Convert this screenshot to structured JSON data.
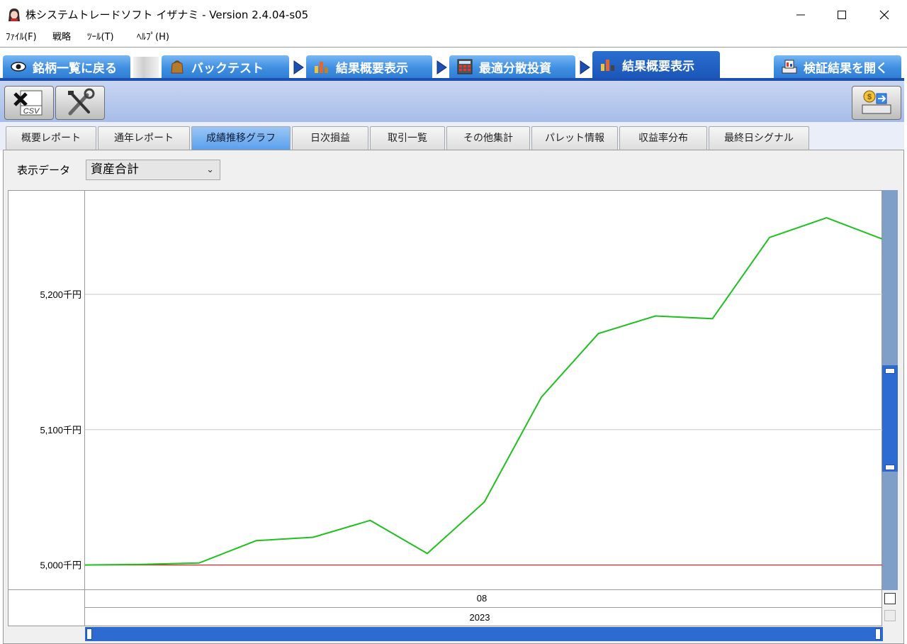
{
  "window": {
    "title": "株システムトレードソフト イザナミ - Version 2.4.04-s05",
    "icon": "app-logo-icon",
    "controls": [
      "minimize-icon",
      "maximize-icon",
      "close-icon"
    ]
  },
  "menu": {
    "items": [
      {
        "label": "ﾌｧｲﾙ(F)"
      },
      {
        "label": "戦略"
      },
      {
        "label": "ﾂｰﾙ(T)"
      },
      {
        "label": "ﾍﾙﾌﾟ(H)"
      }
    ]
  },
  "workflow": {
    "steps": [
      {
        "label": "銘柄一覧に戻る",
        "icon": "eye-icon"
      },
      {
        "label": "バックテスト",
        "icon": "bag-icon"
      },
      {
        "label": "結果概要表示",
        "icon": "bar-chart-icon"
      },
      {
        "label": "最適分散投資",
        "icon": "calculator-icon"
      },
      {
        "label": "結果概要表示",
        "icon": "bar-chart-icon",
        "active": true
      },
      {
        "label": "検証結果を開く",
        "icon": "open-results-icon"
      }
    ]
  },
  "toolbar": {
    "csv_label": "CSV",
    "buttons": [
      "csv-export-icon",
      "tools-icon",
      "money-transfer-icon"
    ]
  },
  "tabs": [
    {
      "label": "概要レポート"
    },
    {
      "label": "通年レポート"
    },
    {
      "label": "成績推移グラフ",
      "active": true
    },
    {
      "label": "日次損益"
    },
    {
      "label": "取引一覧"
    },
    {
      "label": "その他集計"
    },
    {
      "label": "パレット情報"
    },
    {
      "label": "収益率分布"
    },
    {
      "label": "最終日シグナル"
    }
  ],
  "display": {
    "label": "表示データ",
    "selected": "資産合計"
  },
  "chart_data": {
    "type": "line",
    "series": [
      {
        "values": [
          5000,
          5000.5,
          5001.5,
          5018,
          5020.5,
          5033,
          5008.5,
          5046.5,
          5124,
          5171,
          5184,
          5182,
          5242,
          5256.5,
          5240.5
        ],
        "color": "#1fc01f"
      }
    ],
    "baseline": {
      "value": 5000,
      "color": "#cc2b2b"
    },
    "y_ticks": [
      {
        "value": 5000,
        "label": "5,000千円"
      },
      {
        "value": 5100,
        "label": "5,100千円"
      },
      {
        "value": 5200,
        "label": "5,200千円"
      }
    ],
    "ylim": [
      4982,
      5277
    ],
    "x_labels": {
      "month": "08",
      "year": "2023"
    },
    "grid": true
  }
}
